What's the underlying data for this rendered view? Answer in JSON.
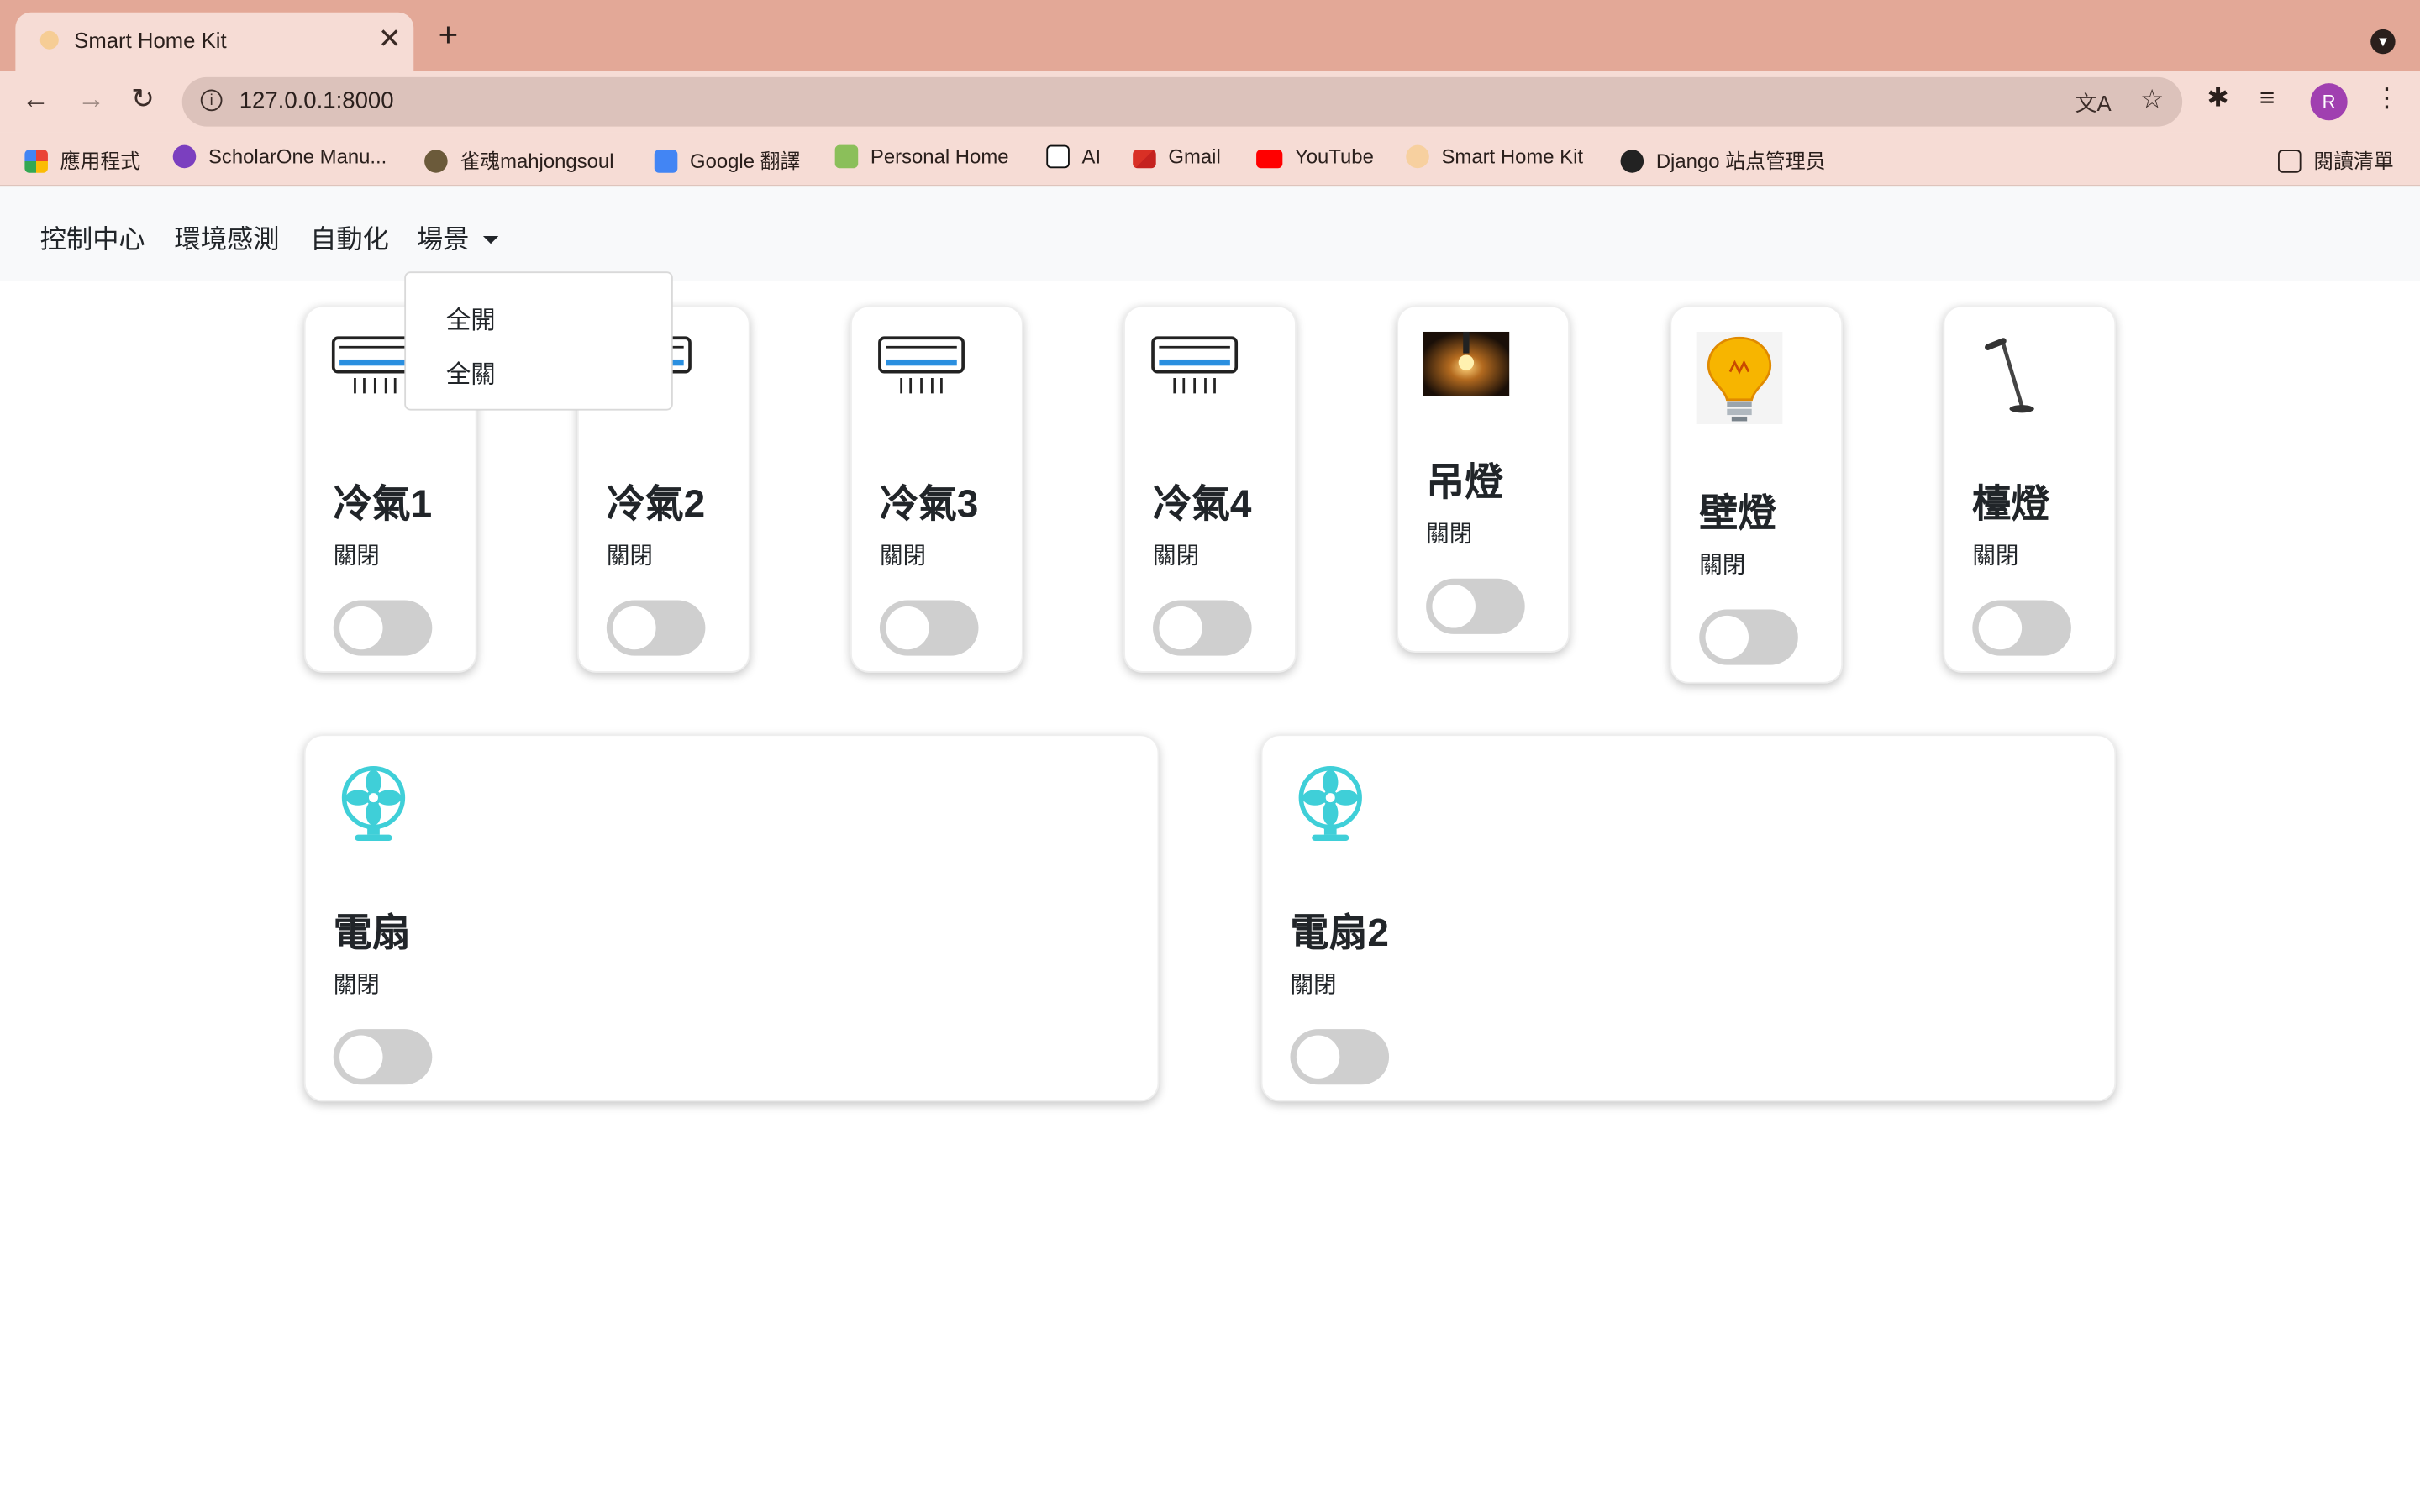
{
  "browser": {
    "tab_title": "Smart Home Kit",
    "close_glyph": "✕",
    "newtab_glyph": "+",
    "url": "127.0.0.1:8000",
    "avatar_letter": "R"
  },
  "bookmarks": [
    {
      "label": "應用程式",
      "icon": "apps-grid-icon",
      "color": "#4285f4"
    },
    {
      "label": "ScholarOne Manu...",
      "icon": "scholarone-icon",
      "color": "#7b3fbf"
    },
    {
      "label": "雀魂mahjongsoul",
      "icon": "mahjongsoul-icon",
      "color": "#6b5a3a"
    },
    {
      "label": "Google 翻譯",
      "icon": "google-translate-icon",
      "color": "#4285f4"
    },
    {
      "label": "Personal Home",
      "icon": "home-icon",
      "color": "#8bbf5a"
    },
    {
      "label": "AI",
      "icon": "notion-icon",
      "color": "#111111"
    },
    {
      "label": "Gmail",
      "icon": "gmail-icon",
      "color": "#d93025"
    },
    {
      "label": "YouTube",
      "icon": "youtube-icon",
      "color": "#ff0000"
    },
    {
      "label": "Smart Home Kit",
      "icon": "smarthome-icon",
      "color": "#f7c36a"
    },
    {
      "label": "Django 站点管理员",
      "icon": "globe-icon",
      "color": "#222222"
    }
  ],
  "reading_list": "閱讀清單",
  "nav": {
    "control": "控制中心",
    "environment": "環境感測",
    "automation": "自動化",
    "scenes": "場景",
    "dropdown": [
      "全開",
      "全關"
    ]
  },
  "devices": [
    {
      "name": "冷氣1",
      "state": "關閉",
      "icon": "air-conditioner-icon",
      "on": false
    },
    {
      "name": "冷氣2",
      "state": "關閉",
      "icon": "air-conditioner-icon",
      "on": false
    },
    {
      "name": "冷氣3",
      "state": "關閉",
      "icon": "air-conditioner-icon",
      "on": false
    },
    {
      "name": "冷氣4",
      "state": "關閉",
      "icon": "air-conditioner-icon",
      "on": false
    },
    {
      "name": "吊燈",
      "state": "關閉",
      "icon": "pendant-lamp-icon",
      "on": false
    },
    {
      "name": "壁燈",
      "state": "關閉",
      "icon": "light-bulb-icon",
      "on": false
    },
    {
      "name": "檯燈",
      "state": "關閉",
      "icon": "desk-lamp-icon",
      "on": false
    }
  ],
  "fans": [
    {
      "name": "電扇",
      "state": "關閉",
      "icon": "fan-icon",
      "on": false
    },
    {
      "name": "電扇2",
      "state": "關閉",
      "icon": "fan-icon",
      "on": false
    }
  ],
  "colors": {
    "toggle_off": "#cfcfcf",
    "fan": "#3fcfd8",
    "ac_blue": "#2a8fe0"
  }
}
